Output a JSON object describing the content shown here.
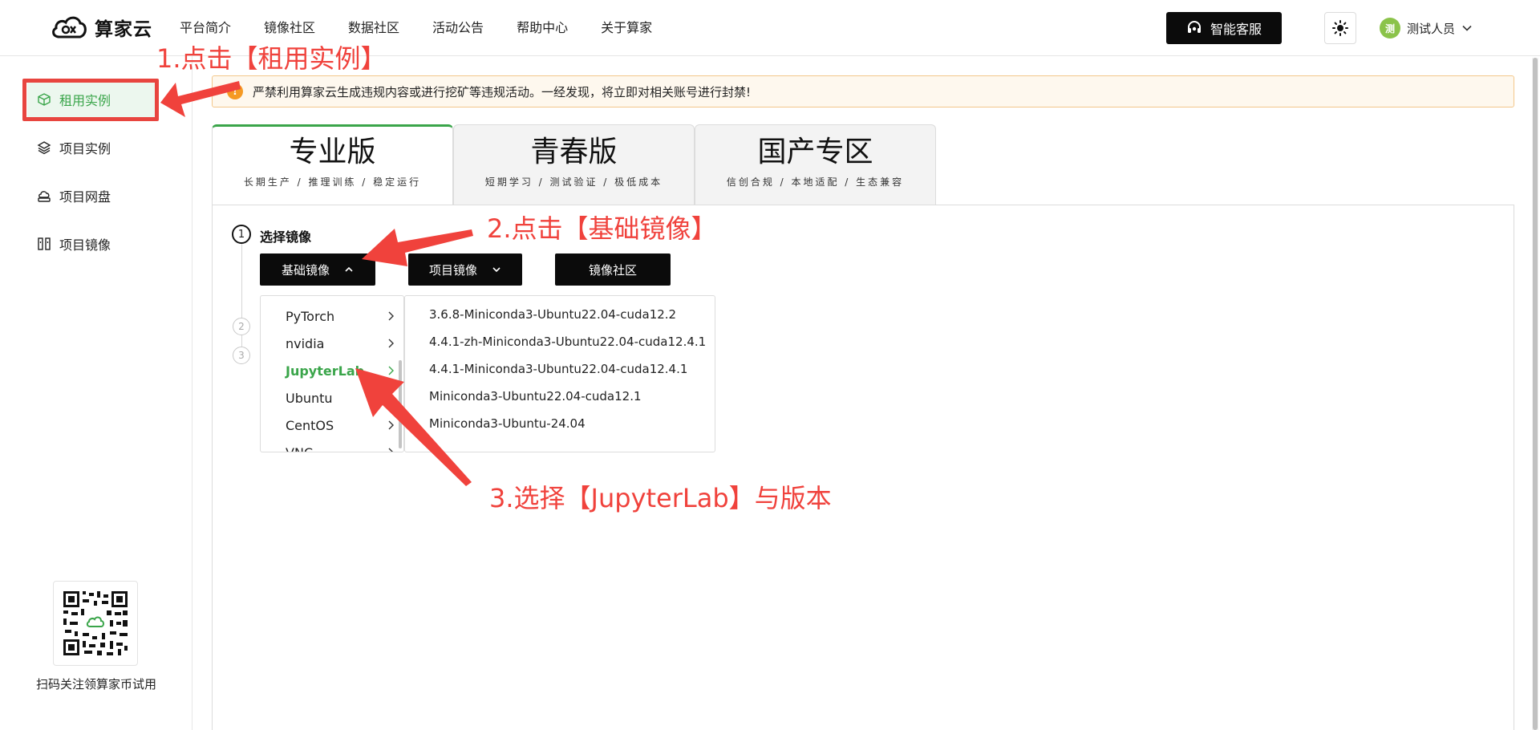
{
  "header": {
    "logo_text": "算家云",
    "nav": [
      "平台简介",
      "镜像社区",
      "数据社区",
      "活动公告",
      "帮助中心",
      "关于算家"
    ],
    "service_label": "智能客服",
    "user_avatar": "测",
    "user_name": "测试人员"
  },
  "sidebar": {
    "items": [
      {
        "label": "租用实例",
        "icon": "cube-icon"
      },
      {
        "label": "项目实例",
        "icon": "layers-icon"
      },
      {
        "label": "项目网盘",
        "icon": "cloud-drive-icon"
      },
      {
        "label": "项目镜像",
        "icon": "mirror-icon"
      }
    ],
    "qr_caption": "扫码关注领算家币试用"
  },
  "notice": {
    "icon": "!",
    "text": "严禁利用算家云生成违规内容或进行挖矿等违规活动。一经发现，将立即对相关账号进行封禁!"
  },
  "tabs": [
    {
      "title": "专业版",
      "subtitle": "长期生产 / 推理训练 / 稳定运行"
    },
    {
      "title": "青春版",
      "subtitle": "短期学习 / 测试验证 / 极低成本"
    },
    {
      "title": "国产专区",
      "subtitle": "信创合规 / 本地适配 / 生态兼容"
    }
  ],
  "steps": {
    "one": "1",
    "two": "2",
    "three": "3",
    "label": "选择镜像"
  },
  "image_buttons": {
    "base": "基础镜像",
    "project": "项目镜像",
    "community": "镜像社区"
  },
  "categories": [
    "PyTorch",
    "nvidia",
    "JupyterLab",
    "Ubuntu",
    "CentOS",
    "VNC"
  ],
  "versions": [
    "3.6.8-Miniconda3-Ubuntu22.04-cuda12.2",
    "4.4.1-zh-Miniconda3-Ubuntu22.04-cuda12.4.1",
    "4.4.1-Miniconda3-Ubuntu22.04-cuda12.4.1",
    "Miniconda3-Ubuntu22.04-cuda12.1",
    "Miniconda3-Ubuntu-24.04"
  ],
  "annotations": {
    "step1": "1.点击【租用实例】",
    "step2": "2.点击【基础镜像】",
    "step3": "3.选择【JupyterLab】与版本"
  },
  "colors": {
    "accent_green": "#3aa54a",
    "annotation_red": "#f0423c",
    "button_black": "#0b0b0b",
    "notice_bg": "#fef8ee"
  }
}
